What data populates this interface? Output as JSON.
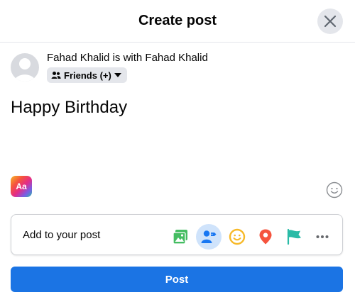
{
  "header": {
    "title": "Create post"
  },
  "user": {
    "line": "Fahad Khalid is with Fahad Khalid",
    "audience_label": "Friends (+)"
  },
  "composer": {
    "text": "Happy Birthday",
    "text_style_label": "Aa"
  },
  "add_to_post": {
    "label": "Add to your post",
    "icons": [
      "photo-video-icon",
      "tag-people-icon",
      "feeling-icon",
      "check-in-icon",
      "life-event-flag-icon",
      "more-icon"
    ]
  },
  "actions": {
    "post_label": "Post"
  },
  "colors": {
    "primary": "#1B74E4",
    "photo": "#45BD62",
    "tag": "#1877F2",
    "feeling": "#F7B928",
    "location": "#F5533D",
    "flag": "#2ABBA7"
  }
}
